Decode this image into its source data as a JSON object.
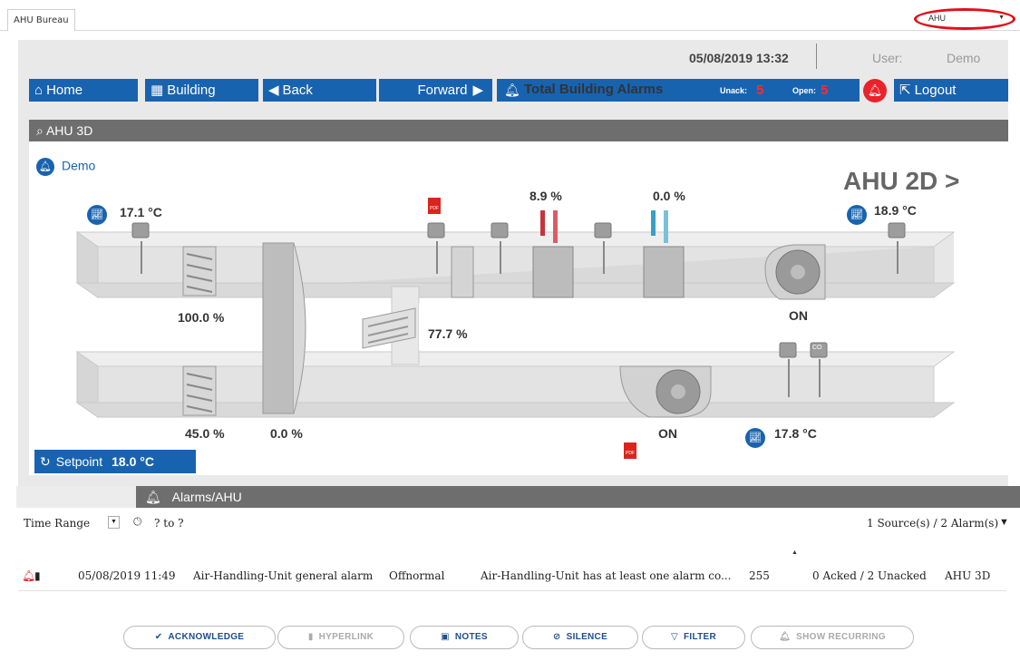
{
  "tab": {
    "label": "AHU Bureau"
  },
  "view_select": {
    "value": "AHU"
  },
  "header": {
    "datetime": "05/08/2019 13:32",
    "user_label": "User:",
    "user_name": "Demo"
  },
  "nav": {
    "home": "Home",
    "building": "Building",
    "back": "Back",
    "forward": "Forward",
    "total_alarms": "Total Building Alarms",
    "unack_label": "Unack:",
    "unack_value": "5",
    "open_label": "Open:",
    "open_value": "5",
    "logout": "Logout"
  },
  "section": {
    "title": "AHU 3D",
    "demo": "Demo",
    "ahu2d_link": "AHU 2D >"
  },
  "readings": {
    "outside_temp": "17.1 °C",
    "supply_temp": "18.9 °C",
    "extract_temp": "17.8 °C",
    "heating_valve": "8.9 %",
    "cooling_valve": "0.0 %",
    "outside_damper": "100.0 %",
    "exhaust_damper": "45.0 %",
    "recirc_damper": "77.7 %",
    "heat_recovery": "0.0 %",
    "supply_fan": "ON",
    "extract_fan": "ON",
    "co2_label": "CO"
  },
  "setpoint": {
    "label": "Setpoint",
    "value": "18.0 °C"
  },
  "alarms": {
    "title": "Alarms/AHU",
    "time_range": "Time Range",
    "range": "? to ?",
    "count": "1 Source(s) / 2 Alarm(s)",
    "rows": [
      {
        "datetime": "05/08/2019 11:49",
        "source": "Air-Handling-Unit general alarm",
        "state": "Offnormal",
        "message": "Air-Handling-Unit has at least one alarm co...",
        "priority": "255",
        "ack": "0 Acked / 2 Unacked",
        "location": "AHU 3D"
      }
    ]
  },
  "buttons": {
    "acknowledge": "ACKNOWLEDGE",
    "hyperlink": "HYPERLINK",
    "notes": "NOTES",
    "silence": "SILENCE",
    "filter": "FILTER",
    "show_recurring": "SHOW RECURRING"
  },
  "colors": {
    "primary": "#1863b0",
    "alarm": "#e8232b",
    "header_gray": "#6e6e6e",
    "heating": "#c8323c",
    "cooling": "#3a9fc3"
  }
}
